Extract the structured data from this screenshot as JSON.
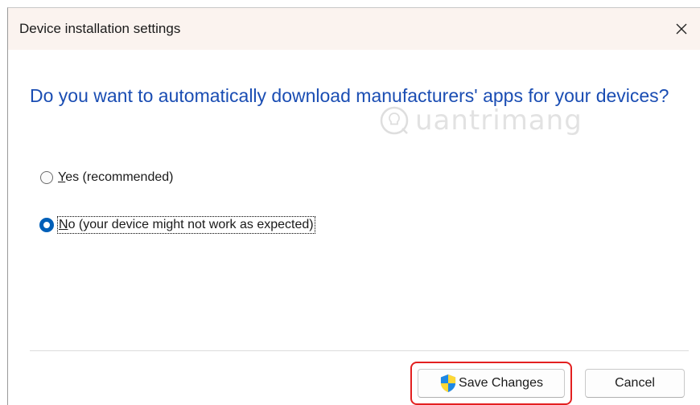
{
  "window": {
    "title": "Device installation settings"
  },
  "question": "Do you want to automatically download manufacturers' apps for your devices?",
  "watermark": "uantrimang",
  "options": [
    {
      "label": "Yes (recommended)",
      "selected": false
    },
    {
      "label": "No (your device might not work as expected)",
      "selected": true
    }
  ],
  "buttons": {
    "save_label": "Save Changes",
    "cancel_label": "Cancel"
  },
  "colors": {
    "question_text": "#1a4db3",
    "radio_selected": "#005fb8",
    "highlight_box": "#e32020",
    "titlebar_bg": "#fbf3ef"
  },
  "icons": {
    "close": "close-icon",
    "shield": "uac-shield-icon",
    "watermark_logo": "watermark-logo-icon"
  }
}
